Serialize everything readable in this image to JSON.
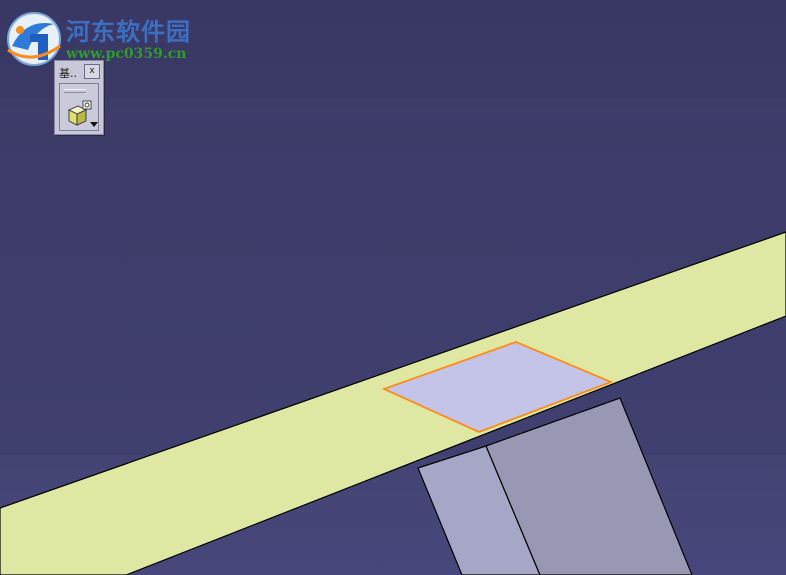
{
  "watermark": {
    "site_name": "河东软件园",
    "site_url": "www.pc0359.cn"
  },
  "toolbar": {
    "title": "基..",
    "close_label": "x",
    "tool_icon": "sketch-cube-icon",
    "dropdown_icon": "dropdown-arrow-icon"
  },
  "scene": {
    "colors": {
      "background": "#3e3d6b",
      "beam_fill": "#dfe8a3",
      "selected_face": "#c4c4e8",
      "selection_outline": "#ff8c1a",
      "leg_left": "#a6a6c7",
      "leg_right": "#9898b5",
      "edge": "#000000"
    }
  }
}
